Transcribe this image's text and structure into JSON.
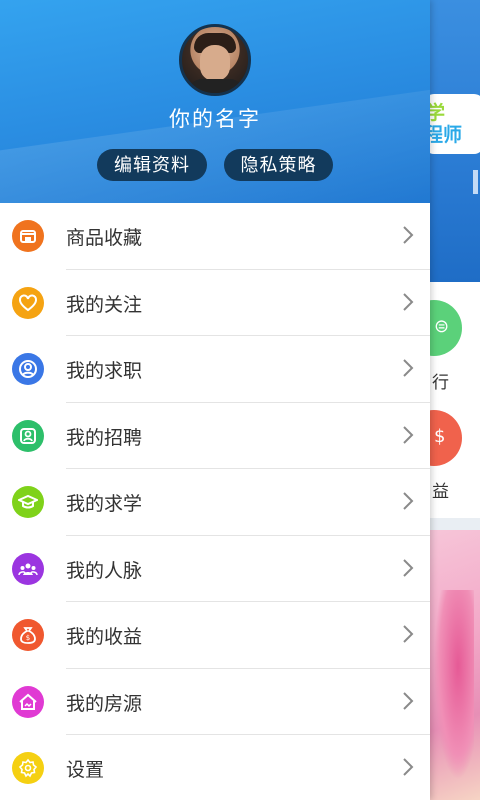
{
  "user": {
    "name": "你的名字",
    "edit_label": "编辑资料",
    "privacy_label": "隐私策略"
  },
  "menu": [
    {
      "label": "商品收藏",
      "icon": "shop-icon",
      "color": "#f0731e"
    },
    {
      "label": "我的关注",
      "icon": "heart-icon",
      "color": "#f5a312"
    },
    {
      "label": "我的求职",
      "icon": "person-search-icon",
      "color": "#3a77e6"
    },
    {
      "label": "我的招聘",
      "icon": "id-card-icon",
      "color": "#2dbf6a"
    },
    {
      "label": "我的求学",
      "icon": "graduation-cap-icon",
      "color": "#7fd21a"
    },
    {
      "label": "我的人脉",
      "icon": "contacts-icon",
      "color": "#9b35e0"
    },
    {
      "label": "我的收益",
      "icon": "money-bag-icon",
      "color": "#f0582f"
    },
    {
      "label": "我的房源",
      "icon": "house-icon",
      "color": "#e03ad3"
    },
    {
      "label": "设置",
      "icon": "settings-icon",
      "color": "#f5d012"
    }
  ],
  "background": {
    "banner_text_1": "学",
    "banner_text_2": "程师",
    "label_1": "行",
    "label_2": "益"
  }
}
